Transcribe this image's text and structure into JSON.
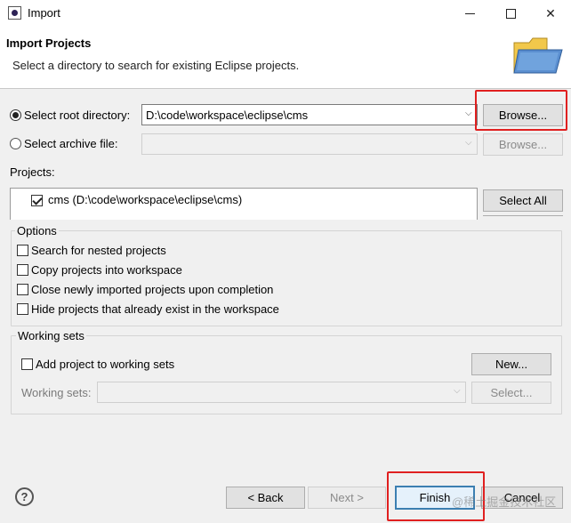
{
  "window": {
    "title": "Import",
    "minimize_icon": "minimize-icon",
    "maximize_icon": "maximize-icon",
    "close_symbol": "✕"
  },
  "header": {
    "title": "Import Projects",
    "description": "Select a directory to search for existing Eclipse projects.",
    "icon": "folder-wizard-icon"
  },
  "source": {
    "root_directory_label": "Select root directory:",
    "root_directory_value": "D:\\code\\workspace\\eclipse\\cms",
    "root_directory_selected": true,
    "archive_label": "Select archive file:",
    "archive_value": "",
    "browse_root_label": "Browse...",
    "browse_archive_label": "Browse...",
    "dropdown_arrow": "⌵"
  },
  "projects": {
    "label": "Projects:",
    "items": [
      {
        "label": "cms (D:\\code\\workspace\\eclipse\\cms)",
        "checked": true
      }
    ],
    "select_all_label": "Select All"
  },
  "options": {
    "title": "Options",
    "items": [
      {
        "label": "Search for nested projects",
        "checked": false
      },
      {
        "label": "Copy projects into workspace",
        "checked": false
      },
      {
        "label": "Close newly imported projects upon completion",
        "checked": false
      },
      {
        "label": "Hide projects that already exist in the workspace",
        "checked": false
      }
    ]
  },
  "working_sets": {
    "title": "Working sets",
    "add_label": "Add project to working sets",
    "add_checked": false,
    "new_label": "New...",
    "sets_label": "Working sets:",
    "select_label": "Select..."
  },
  "footer": {
    "help_symbol": "?",
    "back_label": "< Back",
    "next_label": "Next >",
    "finish_label": "Finish",
    "cancel_label": "Cancel"
  },
  "watermark": "@稀土掘金技术社区",
  "colors": {
    "highlight": "#e02020",
    "primary_button_border": "#3c7fb1",
    "folder_yellow": "#f2c84b",
    "folder_blue": "#5b8fd0"
  }
}
